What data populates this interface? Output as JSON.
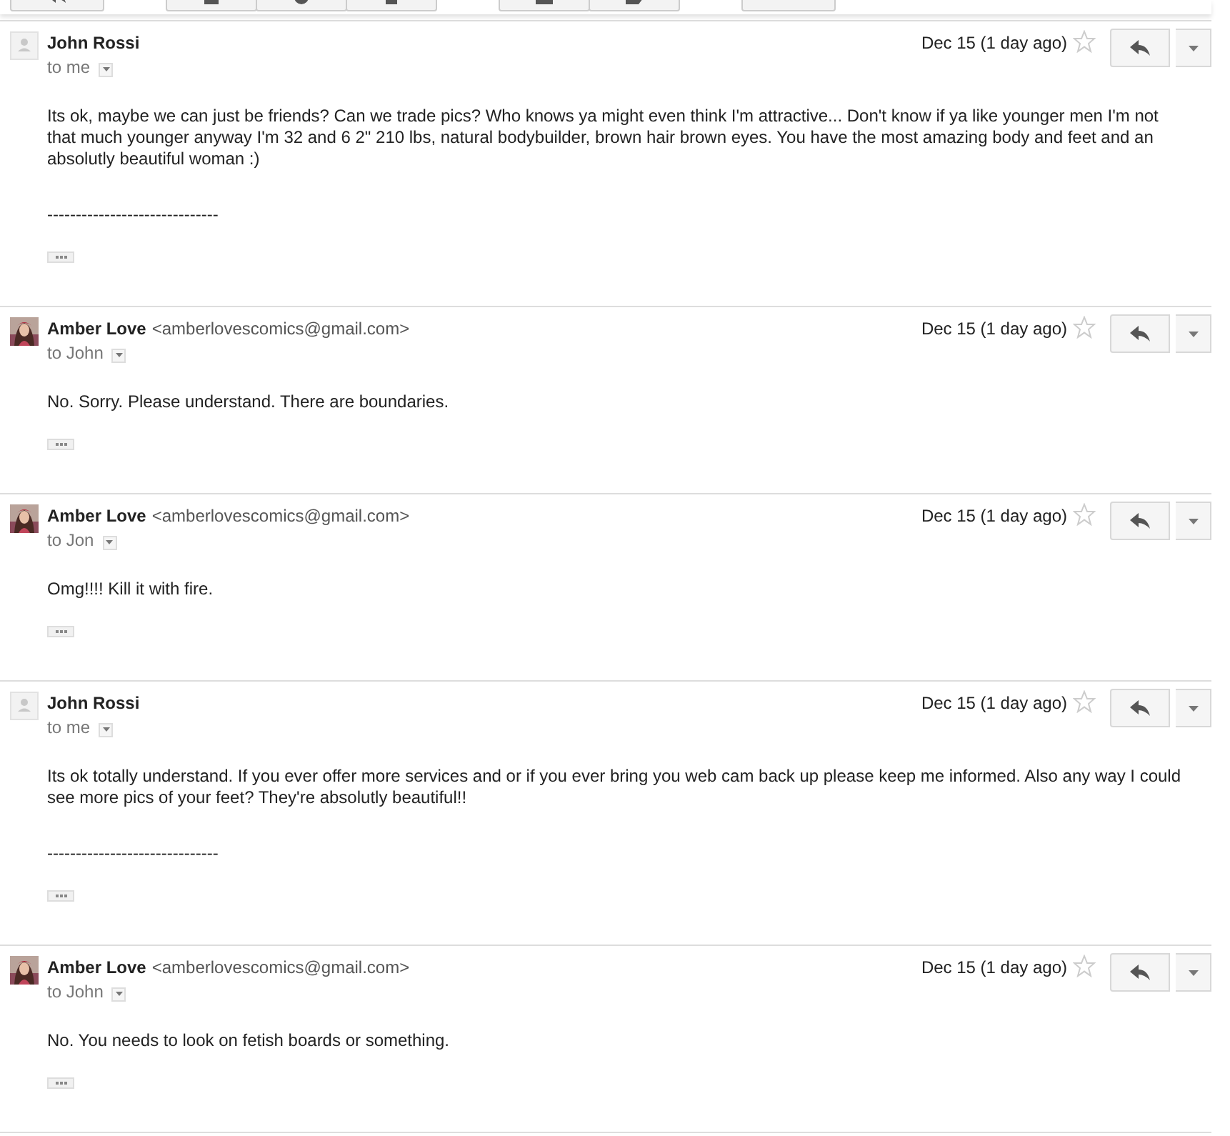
{
  "messages": [
    {
      "kind": "placeholder",
      "sender": "John Rossi",
      "to": "to me",
      "date": "Dec 15 (1 day ago)",
      "starred": false,
      "body": [
        "Its ok, maybe we can just be friends?  Can we trade pics?  Who knows ya might even think I'm attractive...  Don't know if ya like younger men I'm not that much younger anyway I'm 32 and 6 2\" 210 lbs, natural bodybuilder, brown hair brown eyes.  You have the most amazing body and feet and an absolutly beautiful woman :)"
      ],
      "signature": "------------------------------"
    },
    {
      "sender": "Amber Love",
      "email": "<amberlovescomics@gmail.com>",
      "to": "to John",
      "date": "Dec 15 (1 day ago)",
      "starred": false,
      "body": [
        "No. Sorry. Please understand. There are boundaries."
      ]
    },
    {
      "sender": "Amber Love",
      "email": "<amberlovescomics@gmail.com>",
      "to": "to Jon",
      "date": "Dec 15 (1 day ago)",
      "starred": false,
      "body": [
        "Omg!!!! Kill it with fire."
      ]
    },
    {
      "kind": "placeholder",
      "sender": "John Rossi",
      "to": "to me",
      "date": "Dec 15 (1 day ago)",
      "starred": false,
      "body": [
        "Its ok totally understand.  If you ever offer more services and or if you ever bring you web cam back up please keep me informed.  Also any way I could see more pics of your feet?  They're absolutly beautiful!!"
      ],
      "signature": "------------------------------"
    },
    {
      "sender": "Amber Love",
      "email": "<amberlovescomics@gmail.com>",
      "to": "to John",
      "date": "Dec 15 (1 day ago)",
      "starred": false,
      "body": [
        "No. You needs to look on fetish boards or something."
      ]
    }
  ]
}
